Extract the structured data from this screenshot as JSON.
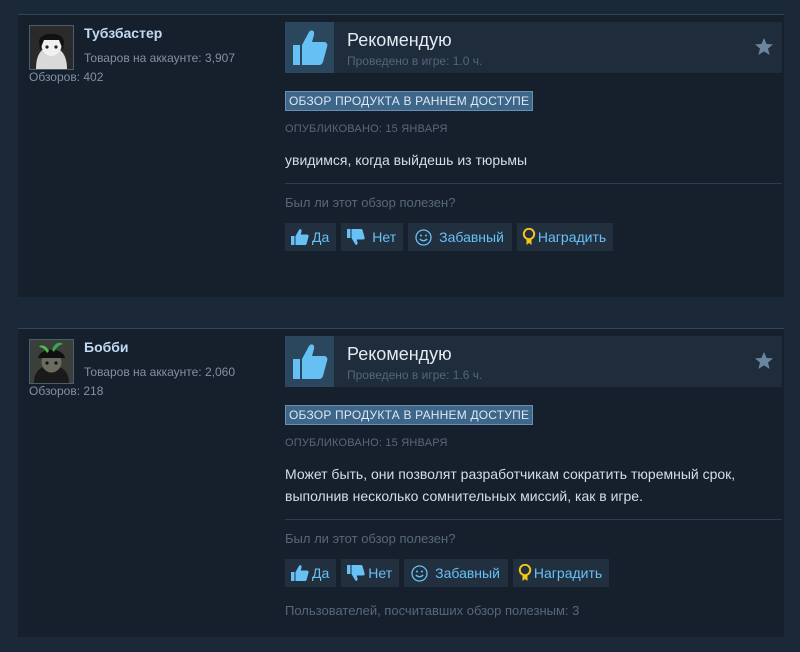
{
  "reviews": [
    {
      "author": {
        "name": "Тубзбастер",
        "products": "Товаров на аккаунте: 3,907",
        "reviews": "Обзоров: 402"
      },
      "vote": "Рекомендую",
      "playtime": "Проведено в игре: 1.0 ч.",
      "badge": "ОБЗОР ПРОДУКТА В РАННЕМ ДОСТУПЕ",
      "posted": "ОПУБЛИКОВАНО: 15 ЯНВАРЯ",
      "content": "увидимся, когда выйдешь из тюрьмы",
      "helpful_question": "Был ли этот обзор полезен?",
      "buttons": {
        "yes": "Да",
        "no": "Нет",
        "funny": "Забавный",
        "award": "Наградить"
      }
    },
    {
      "author": {
        "name": "Бобби",
        "products": "Товаров на аккаунте: 2,060",
        "reviews": "Обзоров: 218"
      },
      "vote": "Рекомендую",
      "playtime": "Проведено в игре: 1.6 ч.",
      "badge": "ОБЗОР ПРОДУКТА В РАННЕМ ДОСТУПЕ",
      "posted": "ОПУБЛИКОВАНО: 15 ЯНВАРЯ",
      "content": "Может быть, они позволят разработчикам сократить тюремный срок, выполнив несколько сомнительных миссий, как в игре.",
      "helpful_question": "Был ли этот обзор полезен?",
      "buttons": {
        "yes": "Да",
        "no": "Нет",
        "funny": "Забавный",
        "award": "Наградить"
      },
      "helpful_count": "Пользователей, посчитавших обзор полезным: 3"
    }
  ],
  "icons": {
    "thumbs_up": "thumbs-up-icon",
    "thumbs_down": "thumbs-down-icon",
    "smiley": "smiley-icon",
    "award": "award-icon",
    "star": "star-icon"
  },
  "colors": {
    "page_bg": "#1b2838",
    "panel_bg": "#16202d",
    "accent_blue": "#67c1f5",
    "badge_bg": "#3e6689",
    "award_gold": "#f5c518"
  }
}
